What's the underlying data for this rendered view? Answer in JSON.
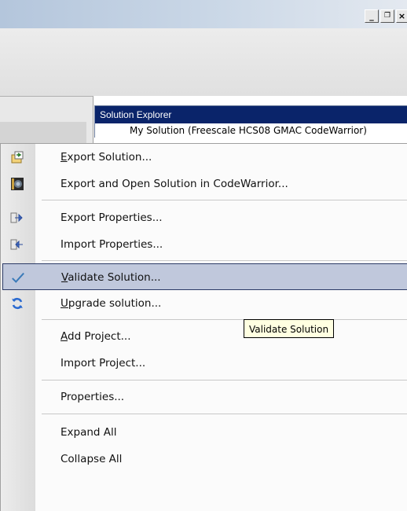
{
  "window": {
    "min_glyph": "_",
    "max_glyph": "🗗",
    "close_glyph": "×"
  },
  "solution_explorer": {
    "title": "Solution Explorer",
    "root_item": "My Solution (Freescale HCS08 GMAC CodeWarrior)"
  },
  "menu": {
    "items": [
      {
        "label": "Export Solution...",
        "accel": "E",
        "icon": "export-solution-icon"
      },
      {
        "label": "Export and Open Solution in CodeWarrior...",
        "icon": "codewarrior-icon"
      },
      {
        "label": "Export Properties...",
        "icon": "export-properties-icon"
      },
      {
        "label": "Import Properties...",
        "icon": "import-properties-icon"
      },
      {
        "label": "Validate Solution...",
        "accel": "V",
        "icon": "checkmark-icon",
        "selected": true
      },
      {
        "label": "Upgrade solution...",
        "accel": "U",
        "icon": "refresh-icon"
      },
      {
        "label": "Add Project...",
        "accel": "A"
      },
      {
        "label": "Import Project..."
      },
      {
        "label": "Properties..."
      },
      {
        "label": "Expand All"
      },
      {
        "label": "Collapse All"
      }
    ]
  },
  "tooltip": {
    "text": "Validate Solution"
  },
  "colors": {
    "selection_bg": "#c0c8dc",
    "selection_border": "#2b3a66",
    "panel_title_bg": "#0a246a",
    "tooltip_bg": "#ffffe1"
  }
}
